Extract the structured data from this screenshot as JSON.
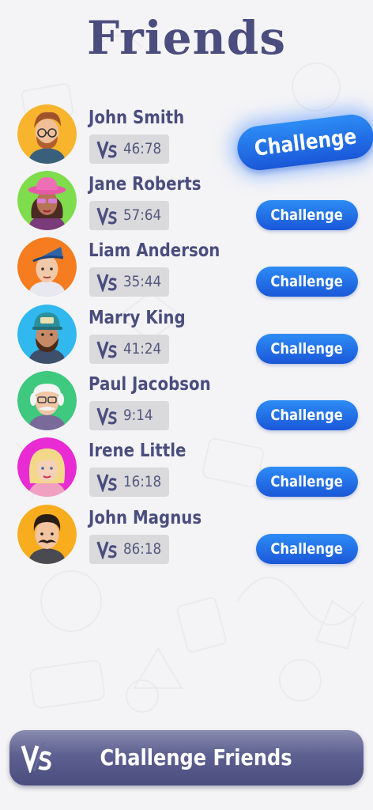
{
  "header": {
    "title": "Friends"
  },
  "friends": [
    {
      "name": "John Smith",
      "score": "46:78",
      "challenge_label": "Challenge",
      "featured": true,
      "avatar_color": "#f7b42c",
      "avatar_icon": "avatar-man-glasses-icon"
    },
    {
      "name": "Jane Roberts",
      "score": "57:64",
      "challenge_label": "Challenge",
      "featured": false,
      "avatar_color": "#7fdc4c",
      "avatar_icon": "avatar-woman-pink-hat-icon"
    },
    {
      "name": "Liam Anderson",
      "score": "35:44",
      "challenge_label": "Challenge",
      "featured": false,
      "avatar_color": "#f57c1f",
      "avatar_icon": "avatar-man-cap-icon"
    },
    {
      "name": "Marry King",
      "score": "41:24",
      "challenge_label": "Challenge",
      "featured": false,
      "avatar_color": "#30b8ef",
      "avatar_icon": "avatar-man-beard-cap-icon"
    },
    {
      "name": "Paul Jacobson",
      "score": "9:14",
      "challenge_label": "Challenge",
      "featured": false,
      "avatar_color": "#3ec97f",
      "avatar_icon": "avatar-old-man-glasses-icon"
    },
    {
      "name": "Irene Little",
      "score": "16:18",
      "challenge_label": "Challenge",
      "featured": false,
      "avatar_color": "#e82bd3",
      "avatar_icon": "avatar-woman-blonde-icon"
    },
    {
      "name": "John Magnus",
      "score": "86:18",
      "challenge_label": "Challenge",
      "featured": false,
      "avatar_color": "#f7ad1e",
      "avatar_icon": "avatar-man-mustache-icon"
    }
  ],
  "cta": {
    "label": "Challenge Friends",
    "icon": "vs-icon"
  },
  "colors": {
    "title": "#4a4d7e",
    "button_blue": "#1f6fe8",
    "score_bg": "#dadadd",
    "cta_bg": "#5d6090"
  }
}
